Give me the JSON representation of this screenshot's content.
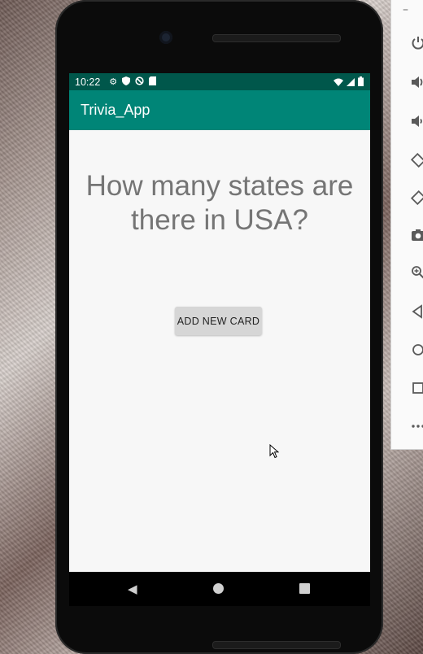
{
  "status_bar": {
    "time": "10:22",
    "left_icons": [
      "gear-icon",
      "shield-icon",
      "no-sign-icon",
      "sd-card-icon"
    ],
    "right_icons": [
      "wifi-icon",
      "signal-icon",
      "battery-icon"
    ]
  },
  "app_bar": {
    "title": "Trivia_App"
  },
  "main": {
    "question": "How many states are there in USA?",
    "add_button_label": "ADD NEW CARD"
  },
  "nav_bar": {
    "items": [
      "back-icon",
      "home-icon",
      "recents-icon"
    ]
  },
  "emulator_toolbar": {
    "minimize_label": "–",
    "items": [
      "power-icon",
      "volume-up-icon",
      "volume-down-icon",
      "rotate-left-icon",
      "rotate-right-icon",
      "camera-icon",
      "zoom-icon",
      "back-icon",
      "home-icon",
      "overview-icon",
      "more-icon"
    ]
  },
  "colors": {
    "status_bar": "#00574b",
    "app_bar": "#008577",
    "screen_bg": "#f7f7f7",
    "question_text": "#757575",
    "button_bg": "#d6d6d6"
  }
}
